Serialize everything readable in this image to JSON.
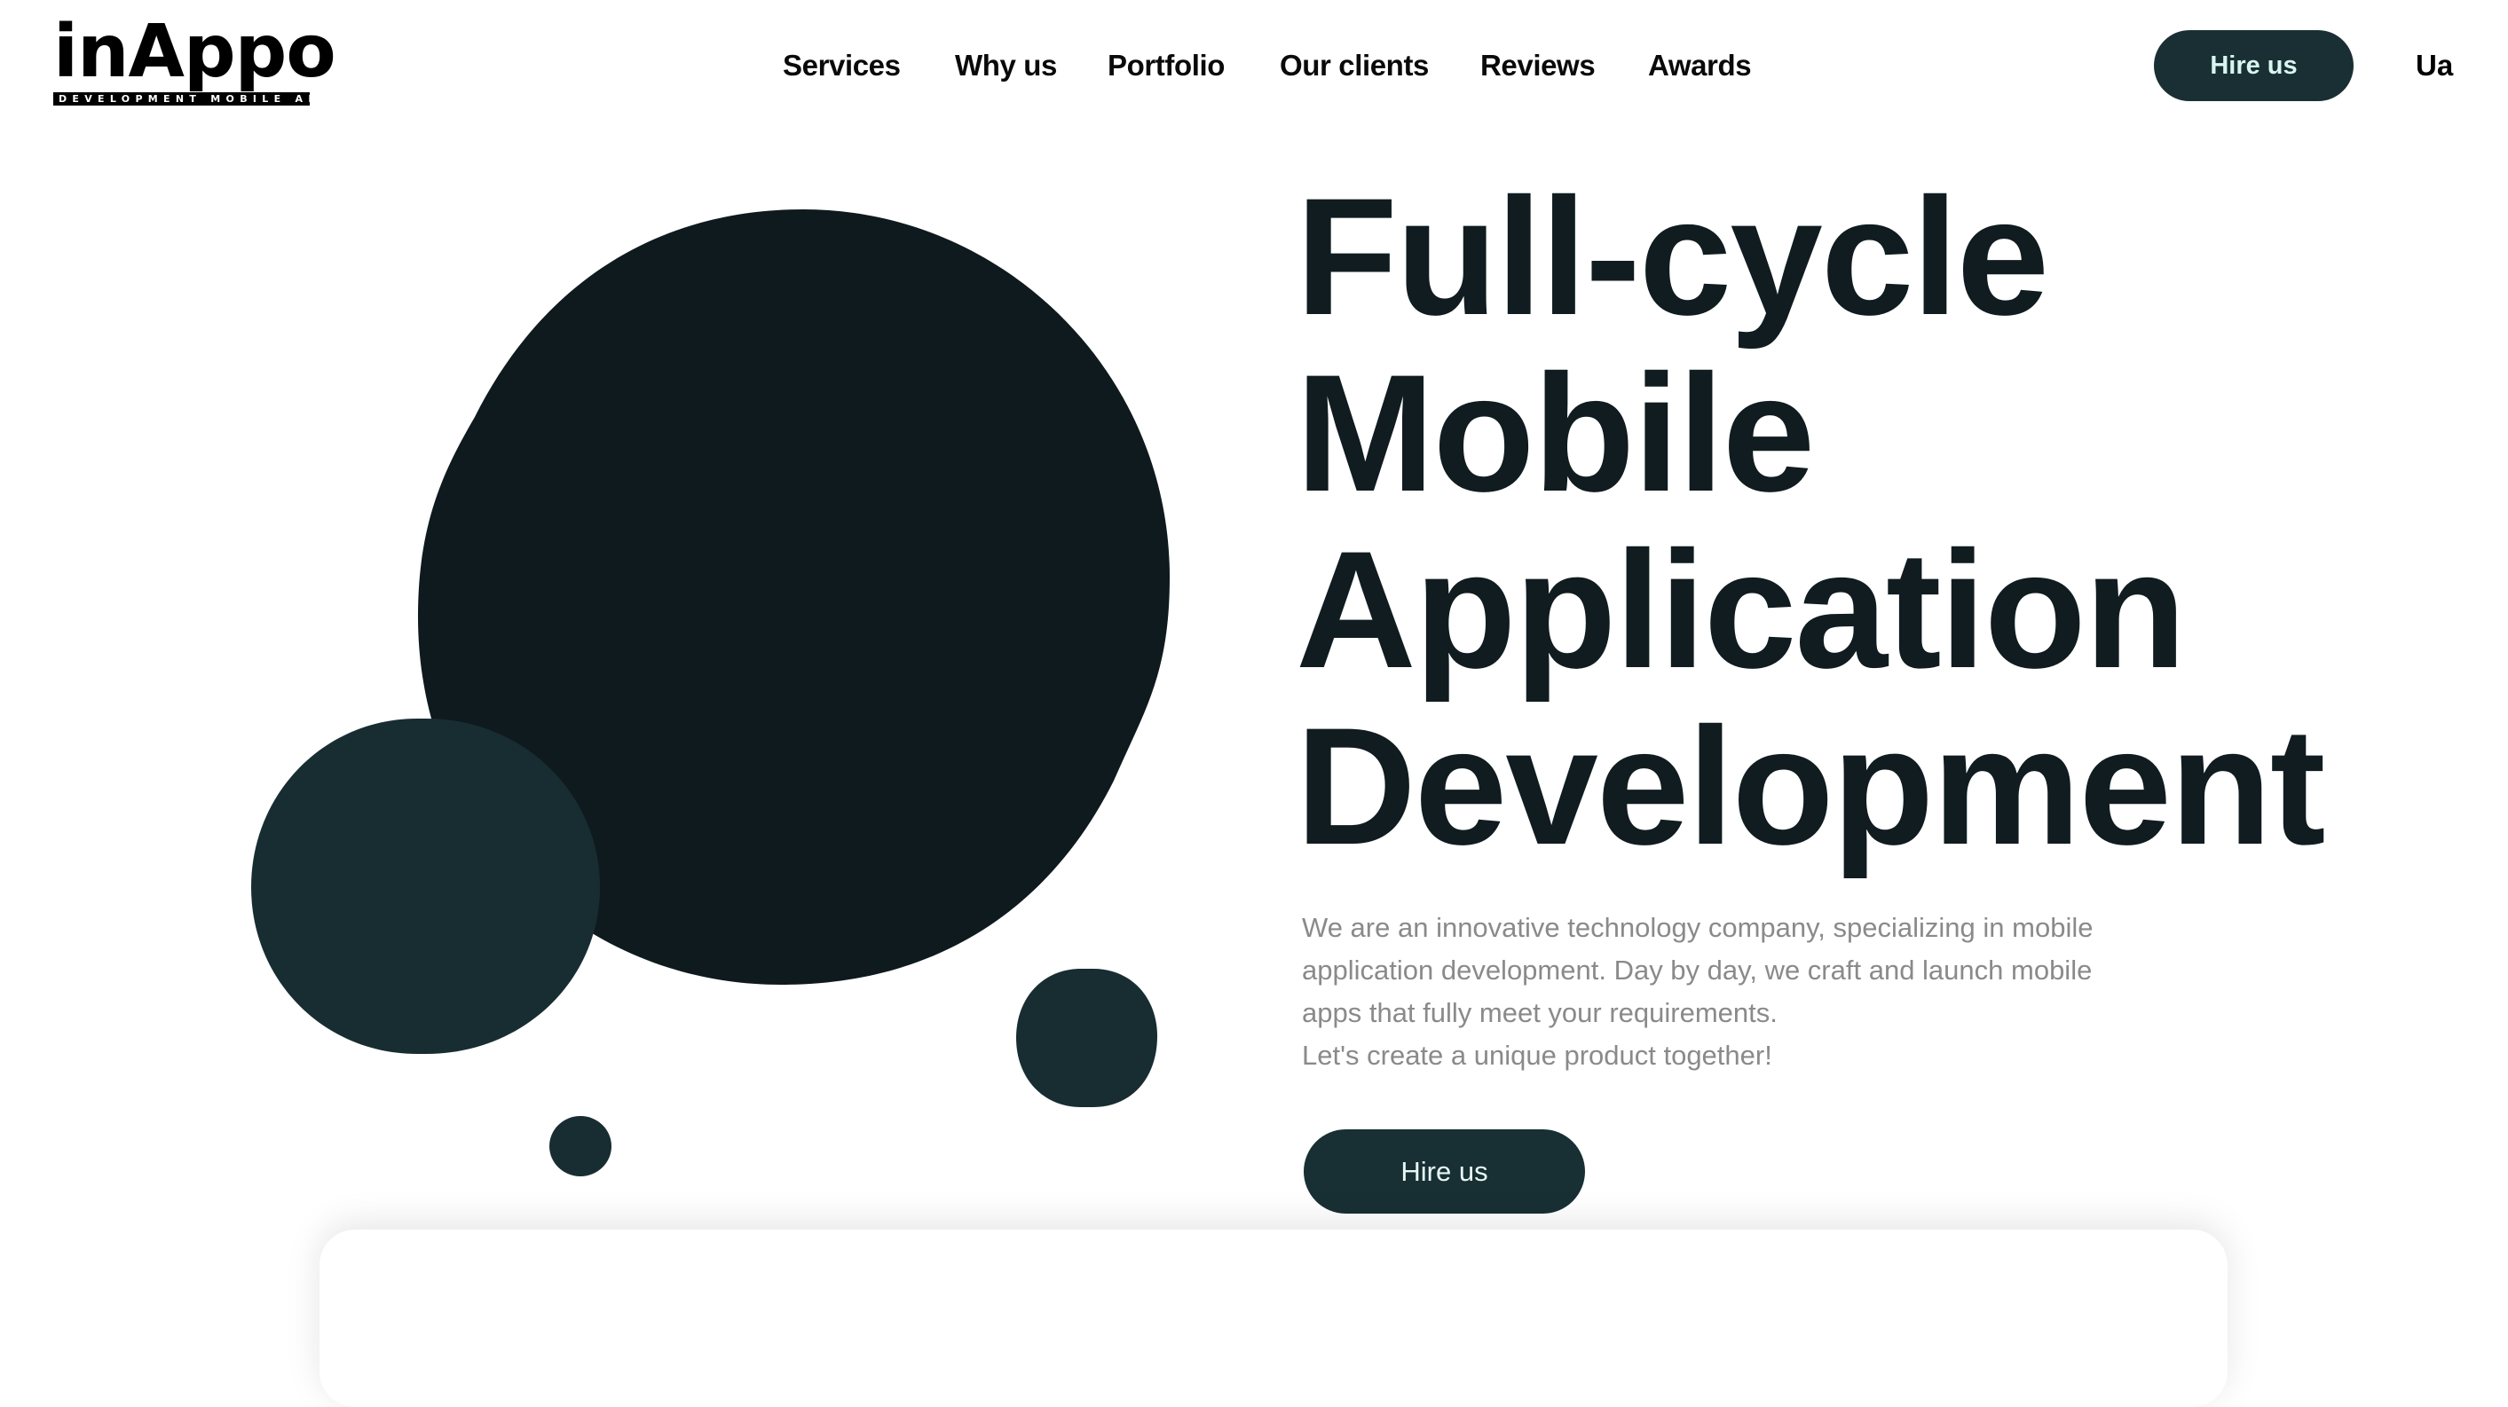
{
  "brand": {
    "name": "inAppo",
    "tagline": "DEVELOPMENT MOBILE APP"
  },
  "nav": {
    "items": [
      {
        "label": "Services"
      },
      {
        "label": "Why us"
      },
      {
        "label": "Portfolio"
      },
      {
        "label": "Our clients"
      },
      {
        "label": "Reviews"
      },
      {
        "label": "Awards"
      }
    ],
    "hire_label": "Hire us",
    "language": "Ua"
  },
  "hero": {
    "title_lines": [
      "Full-cycle",
      "Mobile",
      "Application",
      "Development"
    ],
    "description_lines": [
      "We are an innovative technology company, specializing in mobile",
      "application development. Day by day, we craft and launch mobile",
      "apps that fully meet your requirements.",
      "Let's create a unique product together!"
    ],
    "cta_label": "Hire us"
  },
  "colors": {
    "primary_dark": "#0f1a1e",
    "accent_teal": "#182d32",
    "button_text": "#d8f6f0",
    "heading": "#101c20",
    "body_text": "#8a8a8a"
  }
}
